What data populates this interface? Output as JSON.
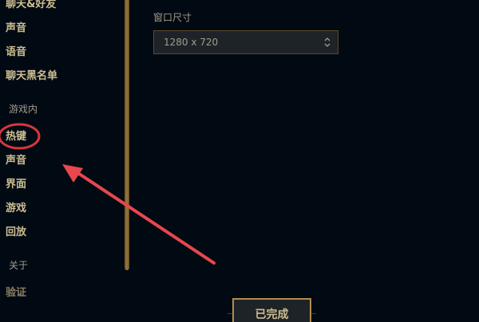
{
  "sidebar": {
    "items": [
      {
        "label": "聊天&好友"
      },
      {
        "label": "声音"
      },
      {
        "label": "语音"
      },
      {
        "label": "聊天黑名单"
      }
    ],
    "section_ingame": "游戏内",
    "ingame_items": [
      {
        "label": "热键"
      },
      {
        "label": "声音"
      },
      {
        "label": "界面"
      },
      {
        "label": "游戏"
      },
      {
        "label": "回放"
      }
    ],
    "section_about": "关于",
    "about_items": [
      {
        "label": "验证"
      }
    ]
  },
  "content": {
    "window_size_label": "窗口尺寸",
    "window_size_value": "1280 x 720",
    "select_icon": "up-down-chevron-icon"
  },
  "footer": {
    "done_label": "已完成"
  },
  "annotation": {
    "circle_color": "#d9363e",
    "arrow_color": "#e8474d"
  },
  "colors": {
    "background": "#010a13",
    "gold_text": "#cdbe91",
    "muted_text": "#a09b8c",
    "border_gold": "#b38c4b"
  }
}
